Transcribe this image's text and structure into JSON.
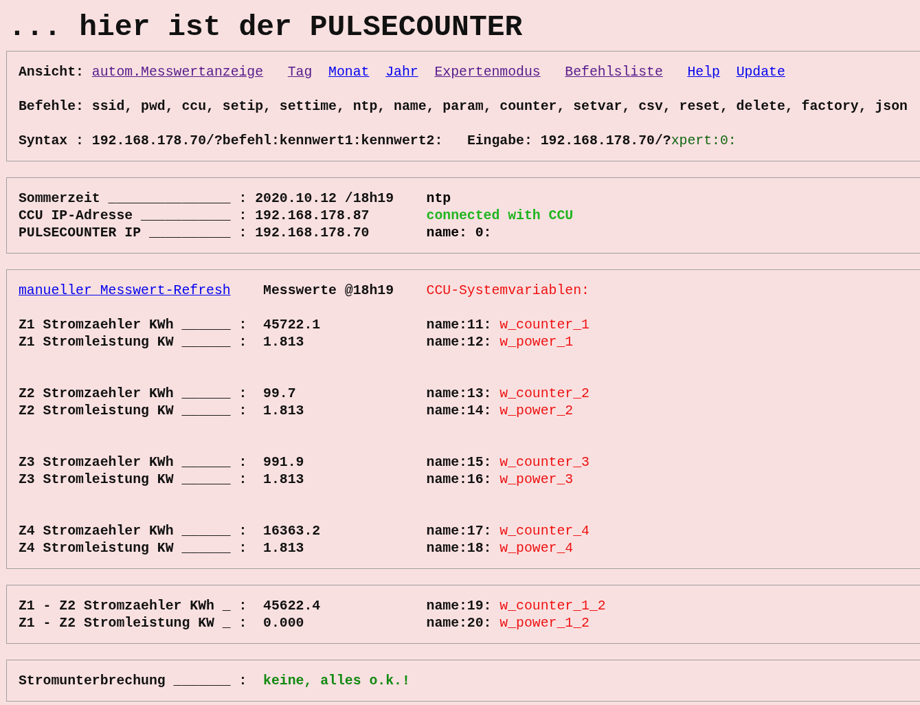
{
  "title": "... hier ist der PULSECOUNTER",
  "nav": {
    "label": "Ansicht:",
    "links": [
      {
        "text": "autom.Messwertanzeige",
        "visited": true
      },
      {
        "text": "Tag",
        "visited": true
      },
      {
        "text": "Monat",
        "visited": false
      },
      {
        "text": "Jahr",
        "visited": false
      },
      {
        "text": "Expertenmodus",
        "visited": true
      },
      {
        "text": "Befehlsliste",
        "visited": true
      },
      {
        "text": "Help",
        "visited": false
      },
      {
        "text": "Update",
        "visited": false
      }
    ]
  },
  "commands": "Befehle: ssid, pwd, ccu, setip, settime, ntp, name, param, counter, setvar, csv, reset, delete, factory, json",
  "syntax": {
    "text": "Syntax : 192.168.178.70/?befehl:kennwert1:kennwert2:",
    "input_label": "Eingabe: 192.168.178.70/?",
    "input_value": "xpert:0:"
  },
  "status": [
    {
      "label": "Sommerzeit _______________",
      "separator": ":",
      "value": "2020.10.12 /18h19",
      "note": "ntp",
      "color": "#000000"
    },
    {
      "label": "CCU IP-Adresse ___________",
      "separator": ":",
      "value": "192.168.178.87",
      "note": "connected with CCU",
      "color": "#1fb41f"
    },
    {
      "label": "PULSECOUNTER IP __________",
      "separator": ":",
      "value": "192.168.178.70",
      "note": "name: 0:",
      "color": "#000000"
    }
  ],
  "measurements": {
    "refresh_link": "manueller Messwert-Refresh",
    "timestamp": "Messwerte @18h19",
    "sysvar_heading": "CCU-Systemvariablen:",
    "groups": [
      [
        {
          "label": "Z1 Stromzaehler KWh ______",
          "separator": ":",
          "value": "45722.1",
          "var_label": "name:11:",
          "var": "w_counter_1"
        },
        {
          "label": "Z1 Stromleistung KW ______",
          "separator": ":",
          "value": "1.813",
          "var_label": "name:12:",
          "var": "w_power_1"
        }
      ],
      [
        {
          "label": "Z2 Stromzaehler KWh ______",
          "separator": ":",
          "value": "99.7",
          "var_label": "name:13:",
          "var": "w_counter_2"
        },
        {
          "label": "Z2 Stromleistung KW ______",
          "separator": ":",
          "value": "1.813",
          "var_label": "name:14:",
          "var": "w_power_2"
        }
      ],
      [
        {
          "label": "Z3 Stromzaehler KWh ______",
          "separator": ":",
          "value": "991.9",
          "var_label": "name:15:",
          "var": "w_counter_3"
        },
        {
          "label": "Z3 Stromleistung KW ______",
          "separator": ":",
          "value": "1.813",
          "var_label": "name:16:",
          "var": "w_power_3"
        }
      ],
      [
        {
          "label": "Z4 Stromzaehler KWh ______",
          "separator": ":",
          "value": "16363.2",
          "var_label": "name:17:",
          "var": "w_counter_4"
        },
        {
          "label": "Z4 Stromleistung KW ______",
          "separator": ":",
          "value": "1.813",
          "var_label": "name:18:",
          "var": "w_power_4"
        }
      ]
    ]
  },
  "difference": [
    {
      "label": "Z1 - Z2 Stromzaehler KWh _",
      "separator": ":",
      "value": "45622.4",
      "var_label": "name:19:",
      "var": "w_counter_1_2"
    },
    {
      "label": "Z1 - Z2 Stromleistung KW _",
      "separator": ":",
      "value": "0.000",
      "var_label": "name:20:",
      "var": "w_power_1_2"
    }
  ],
  "outage": {
    "label": "Stromunterbrechung _______",
    "separator": ":",
    "value": "keine, alles o.k.!"
  }
}
